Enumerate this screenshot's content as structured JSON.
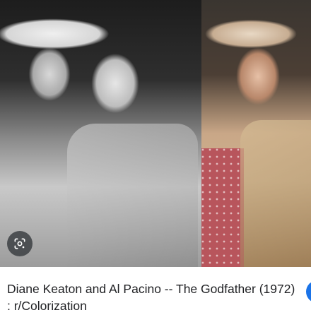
{
  "result": {
    "image_alt": "Diane Keaton and Al Pacino black and white photo beside colorized version",
    "caption": "Diane Keaton and Al Pacino -- The Godfather (1972) : r/Colorization",
    "lens_icon": "google-lens-icon",
    "accent_color": "#1a73e8"
  }
}
